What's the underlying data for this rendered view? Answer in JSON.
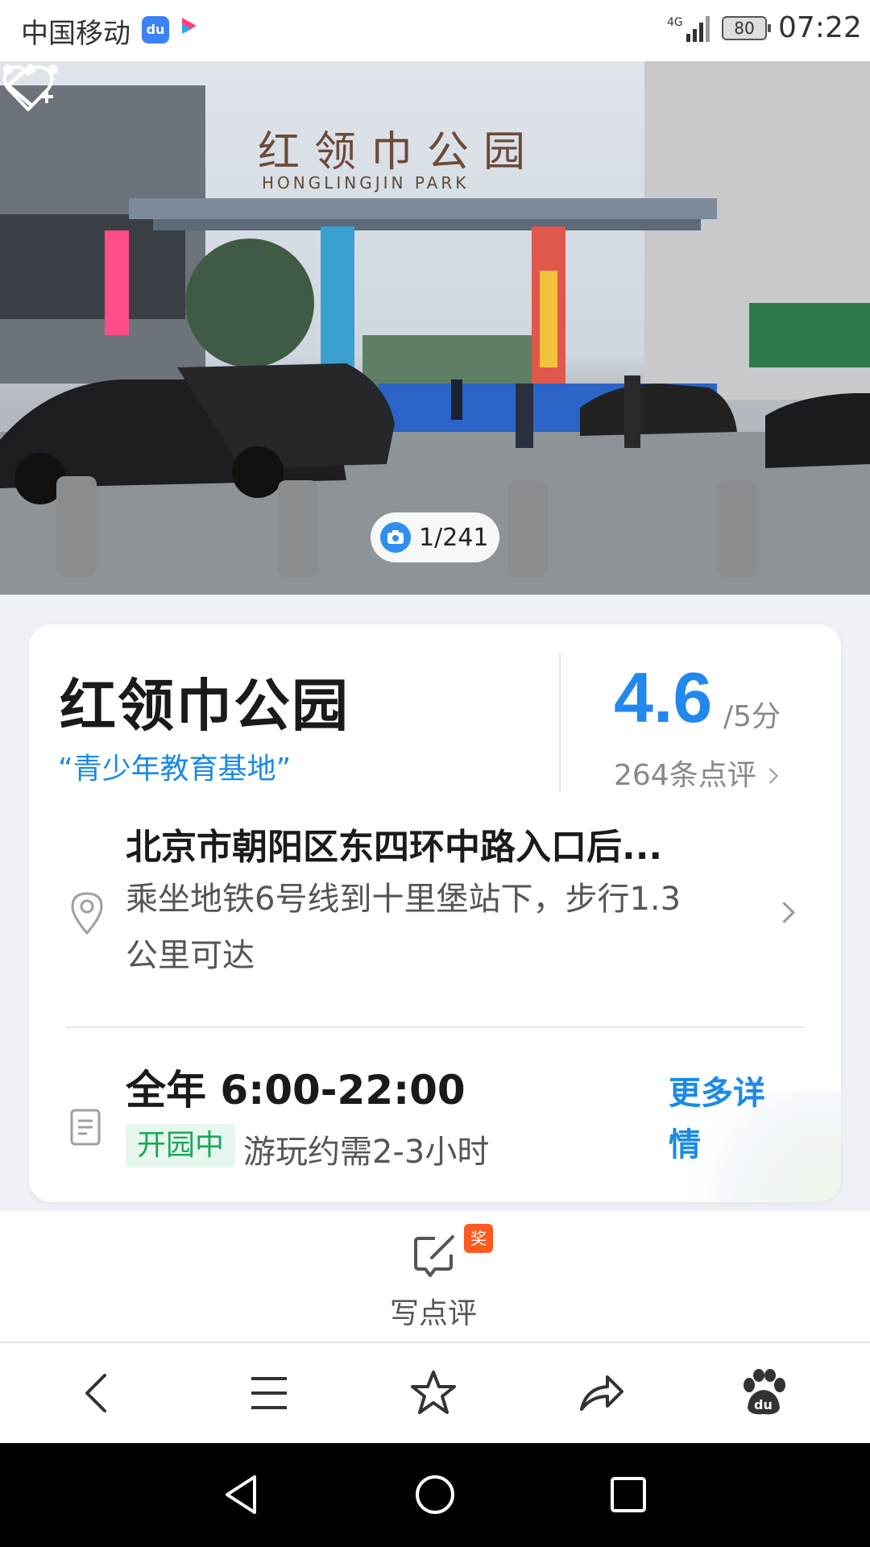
{
  "status_bar": {
    "carrier": "中国移动",
    "baidu_app_label": "du",
    "network": "4G",
    "battery": "80",
    "time": "07:22"
  },
  "hero": {
    "photo_counter": "1/241",
    "icons": [
      "back-icon",
      "favorite-add-icon",
      "more-icon",
      "camera-icon"
    ]
  },
  "place": {
    "name": "红领巾公园",
    "slogan": "“青少年教育基地”",
    "rating": "4.6",
    "rating_max": "/5分",
    "review_count": "264条点评",
    "address": "北京市朝阳区东四环中路入口后...",
    "directions": "乘坐地铁6号线到十里堡站下，步行1.3公里可达",
    "hours": "全年 6:00-22:00",
    "open_status": "开园中",
    "duration": "游玩约需2-3小时",
    "more_details": "更多详情"
  },
  "review_bar": {
    "write_label": "写点评",
    "award_badge": "奖"
  },
  "browser_toolbar": {
    "items": [
      "back-icon",
      "menu-icon",
      "star-icon",
      "share-icon",
      "baidu-paw-icon"
    ]
  },
  "android_nav": {
    "items": [
      "nav-back-icon",
      "nav-home-icon",
      "nav-recent-icon"
    ]
  },
  "colors": {
    "accent_blue": "#2288ee",
    "link_blue": "#1a8ae5",
    "open_green": "#1fa55a",
    "badge_orange": "#ff5a1f"
  }
}
